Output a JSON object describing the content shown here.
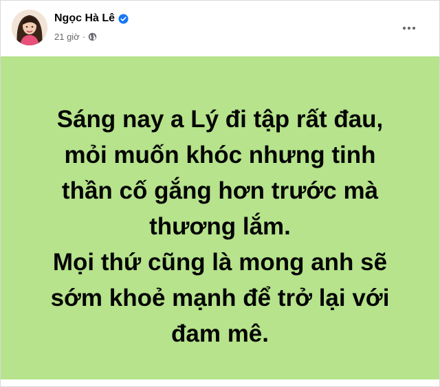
{
  "post": {
    "author": {
      "name": "Ngọc Hà Lê",
      "verified_icon": "verified-badge-icon"
    },
    "meta": {
      "time": "21 giờ",
      "separator": "·",
      "audience_icon": "globe-icon"
    },
    "more_icon": "more-options-icon",
    "background_color": "#b6e38b",
    "lines": [
      "Sáng nay a Lý đi tập rất đau,",
      "mỏi muốn khóc nhưng tinh",
      "thần cố gắng hơn trước mà",
      "thương lắm.",
      "Mọi thứ cũng là mong anh sẽ",
      "sớm khoẻ mạnh để trở lại với",
      "đam mê."
    ]
  }
}
